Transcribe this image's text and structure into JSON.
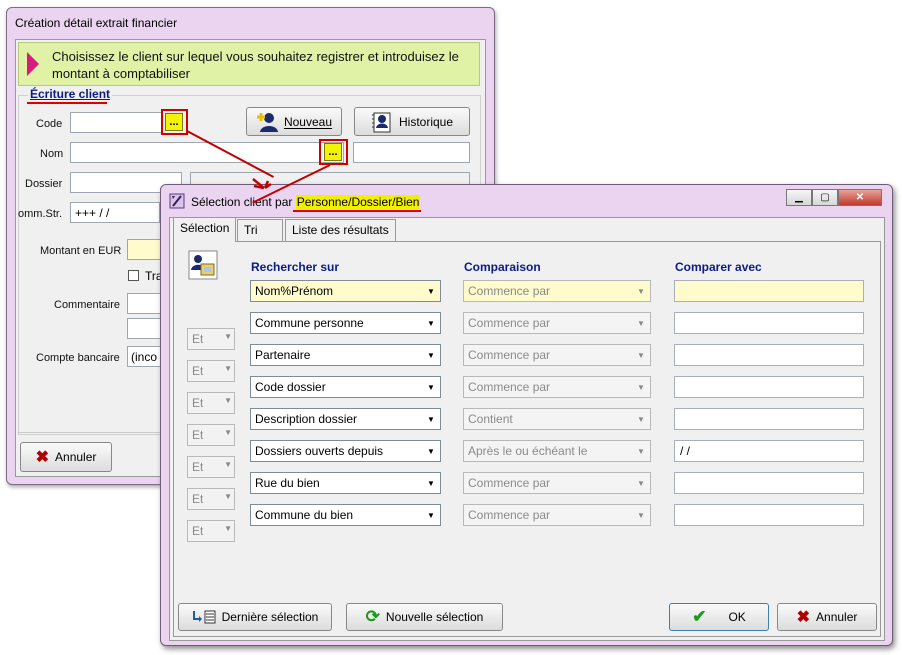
{
  "window1": {
    "title": "Création détail extrait financier",
    "banner": "Choisissez le client sur lequel vous souhaitez registrer et introduisez le montant à comptabiliser",
    "group_title": "Écriture client",
    "labels": {
      "code": "Code",
      "nom": "Nom",
      "dossier": "Dossier",
      "comm": "omm.Str.",
      "montant": "Montant en EUR",
      "tra": "Tra",
      "commentaire": "Commentaire",
      "compte": "Compte bancaire"
    },
    "values": {
      "comm_value": "+++  /   /",
      "comm_plus": "+",
      "compte_value": "(inco"
    },
    "buttons": {
      "dots": "...",
      "nouveau": "Nouveau",
      "historique": "Historique",
      "annuler": "Annuler"
    }
  },
  "window2": {
    "title_prefix": "Sélection client par ",
    "title_highlight": "Personne/Dossier/Bien",
    "tabs": [
      "Sélection",
      "Tri",
      "Liste des résultats"
    ],
    "headers": {
      "rechercher": "Rechercher sur",
      "comparaison": "Comparaison",
      "comparer": "Comparer avec"
    },
    "et_label": "Et",
    "rows": [
      {
        "field": "Nom%Prénom",
        "comparison": "Commence par",
        "value": ""
      },
      {
        "field": "Commune personne",
        "comparison": "Commence par",
        "value": ""
      },
      {
        "field": "Partenaire",
        "comparison": "Commence par",
        "value": ""
      },
      {
        "field": "Code dossier",
        "comparison": "Commence par",
        "value": ""
      },
      {
        "field": "Description dossier",
        "comparison": "Contient",
        "value": ""
      },
      {
        "field": "Dossiers ouverts depuis",
        "comparison": "Après le ou échéant le",
        "value": " /  /"
      },
      {
        "field": "Rue du bien",
        "comparison": "Commence par",
        "value": ""
      },
      {
        "field": "Commune du bien",
        "comparison": "Commence par",
        "value": ""
      }
    ],
    "buttons": {
      "derniere": "Dernière sélection",
      "nouvelle": "Nouvelle sélection",
      "ok": "OK",
      "annuler": "Annuler"
    }
  },
  "colors": {
    "highlight": "#f0f000",
    "annotation_red": "#d00000",
    "banner_bg": "#dff2a6",
    "window_frame": "#ead4f0",
    "header_blue": "#0b1b86"
  }
}
